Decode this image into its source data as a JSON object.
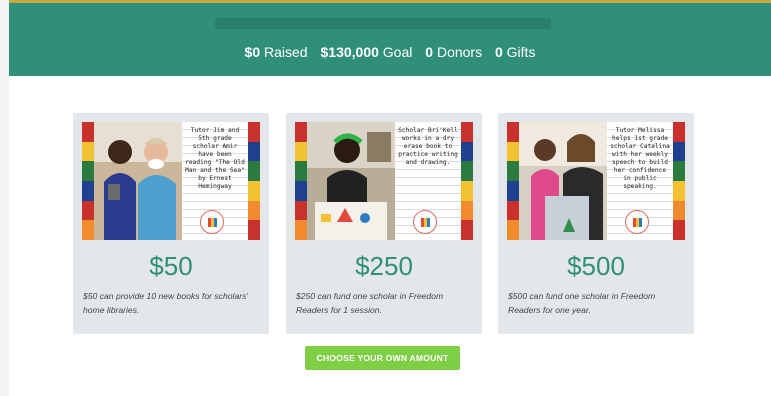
{
  "campaign": {
    "progress_fraction": 0,
    "stats": {
      "raised_value": "$0",
      "raised_label": "Raised",
      "goal_value": "$130,000",
      "goal_label": "Goal",
      "donors_value": "0",
      "donors_label": "Donors",
      "gifts_value": "0",
      "gifts_label": "Gifts"
    }
  },
  "gift_options": [
    {
      "amount": "$50",
      "description": "$50 can provide 10 new books for scholars' home libraries.",
      "note": "Tutor Jim and 5th grade scholar Amir have been reading \"The Old Man and the Sea\" by Ernest Hemingway"
    },
    {
      "amount": "$250",
      "description": "$250 can fund one scholar in Freedom Readers for 1 session.",
      "note": "Scholar Bri'Kell works in a dry erase book to practice writing and drawing."
    },
    {
      "amount": "$500",
      "description": "$500 can fund one scholar in Freedom Readers for one year.",
      "note": "Tutor Melissa helps 1st grade scholar Catalina with her weekly speech to build her confidence in public speaking."
    }
  ],
  "choose_button_label": "CHOOSE YOUR OWN AMOUNT",
  "colors": {
    "header": "#2f8f79",
    "amount": "#2f8f79",
    "button": "#7ecf45",
    "card": "#e4e7ea"
  }
}
